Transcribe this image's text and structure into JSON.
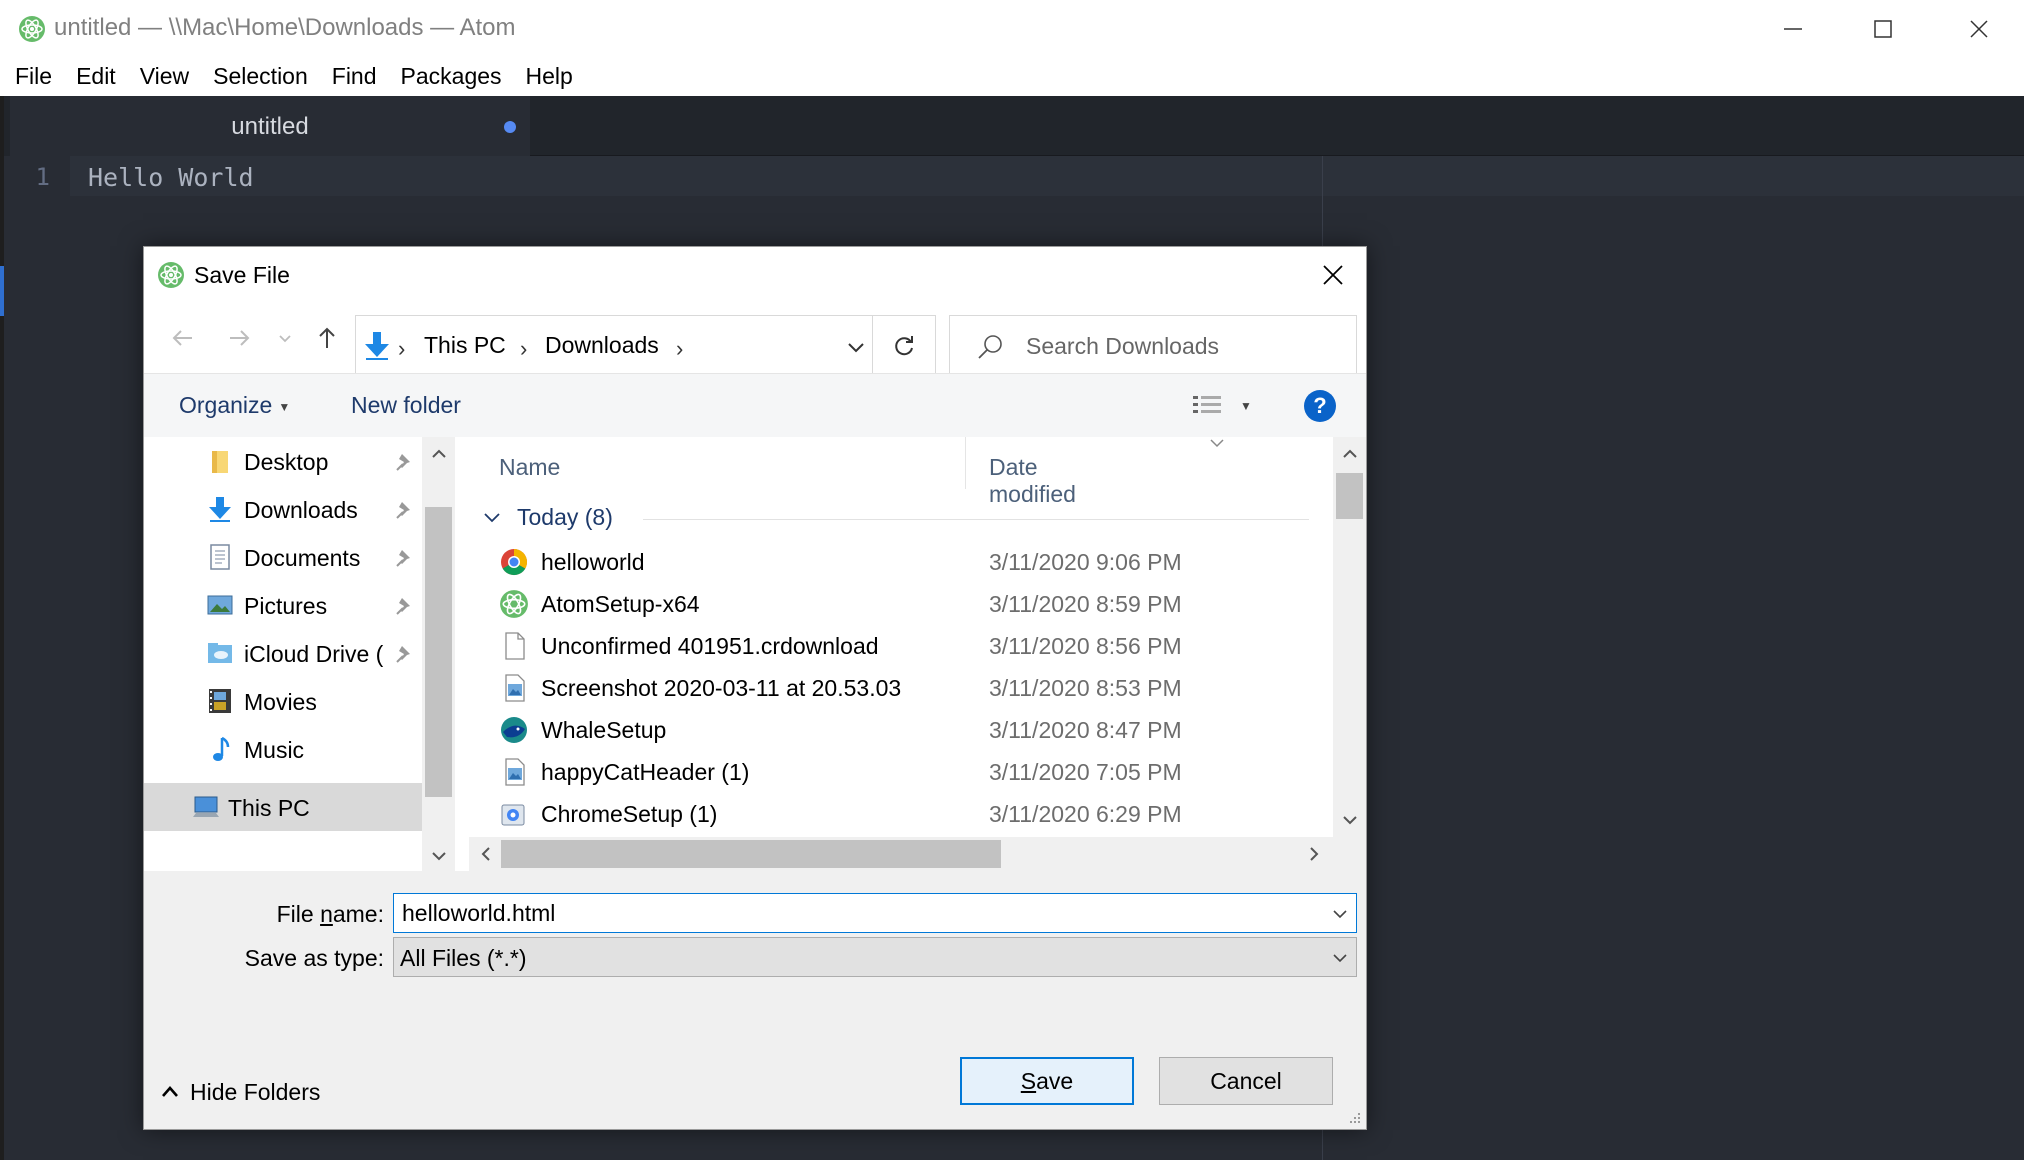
{
  "window": {
    "title": "untitled — \\\\Mac\\Home\\Downloads — Atom",
    "icon": "atom-icon"
  },
  "menu": [
    "File",
    "Edit",
    "View",
    "Selection",
    "Find",
    "Packages",
    "Help"
  ],
  "editor": {
    "tab_label": "untitled",
    "line_number": "1",
    "code": "Hello World",
    "accent": "#568af2"
  },
  "dialog": {
    "title": "Save File",
    "breadcrumb": [
      "This PC",
      "Downloads"
    ],
    "search_placeholder": "Search Downloads",
    "toolbar": {
      "organize": "Organize",
      "new_folder": "New folder",
      "help": "?"
    },
    "nav_items": [
      {
        "label": "Desktop",
        "icon": "folder-icon",
        "pinned": true
      },
      {
        "label": "Downloads",
        "icon": "download-icon",
        "pinned": true
      },
      {
        "label": "Documents",
        "icon": "document-icon",
        "pinned": true
      },
      {
        "label": "Pictures",
        "icon": "pictures-icon",
        "pinned": true
      },
      {
        "label": "iCloud Drive (",
        "icon": "cloud-folder-icon",
        "pinned": true
      },
      {
        "label": "Movies",
        "icon": "film-icon",
        "pinned": false
      },
      {
        "label": "Music",
        "icon": "music-icon",
        "pinned": false
      },
      {
        "label": "This PC",
        "icon": "computer-icon",
        "pinned": false,
        "selected": true
      }
    ],
    "columns": {
      "name": "Name",
      "date": "Date modified"
    },
    "group": "Today (8)",
    "files": [
      {
        "name": "helloworld",
        "date": "3/11/2020 9:06 PM",
        "icon": "chrome-icon"
      },
      {
        "name": "AtomSetup-x64",
        "date": "3/11/2020 8:59 PM",
        "icon": "atom-icon"
      },
      {
        "name": "Unconfirmed 401951.crdownload",
        "date": "3/11/2020 8:56 PM",
        "icon": "blank-file-icon"
      },
      {
        "name": "Screenshot 2020-03-11 at 20.53.03",
        "date": "3/11/2020 8:53 PM",
        "icon": "image-file-icon"
      },
      {
        "name": "WhaleSetup",
        "date": "3/11/2020 8:47 PM",
        "icon": "whale-icon"
      },
      {
        "name": "happyCatHeader (1)",
        "date": "3/11/2020 7:05 PM",
        "icon": "image-file-icon"
      },
      {
        "name": "ChromeSetup (1)",
        "date": "3/11/2020 6:29 PM",
        "icon": "installer-icon"
      }
    ],
    "file_name_label_pre": "File ",
    "file_name_label_u": "n",
    "file_name_label_post": "ame:",
    "file_name_value": "helloworld.html",
    "save_type_label": "Save as type:",
    "save_type_value": "All Files (*.*)",
    "hide_folders": "Hide Folders",
    "save_button_u": "S",
    "save_button_rest": "ave",
    "cancel_button": "Cancel"
  }
}
